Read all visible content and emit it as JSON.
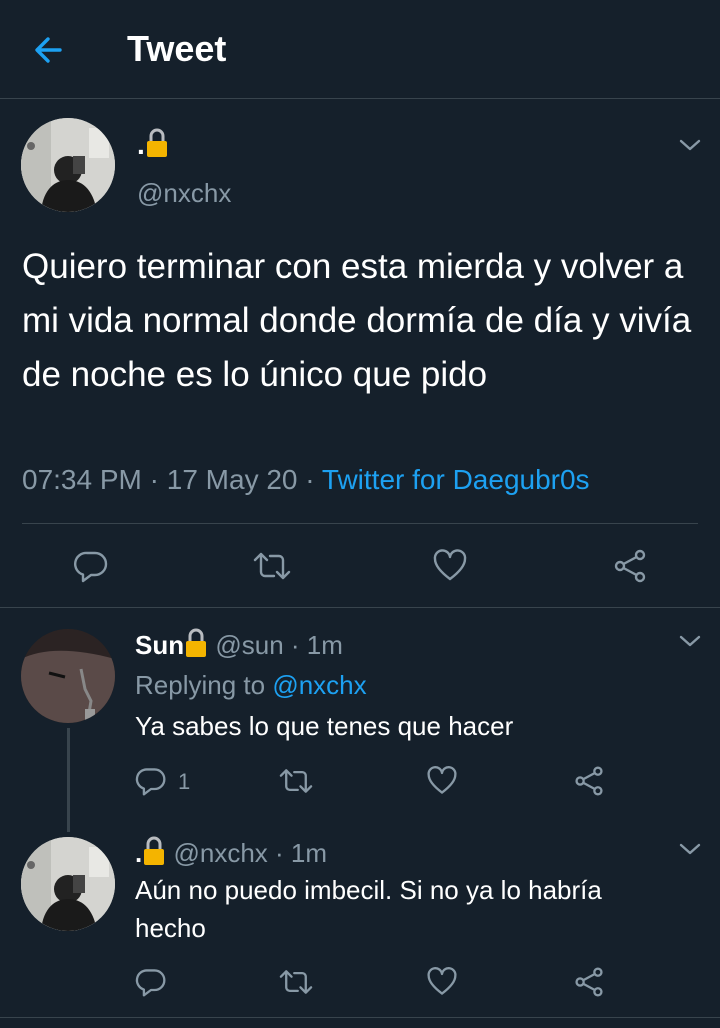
{
  "header": {
    "title": "Tweet"
  },
  "main_tweet": {
    "display_name": ".",
    "handle": "@nxchx",
    "text": "Quiero terminar con esta mierda y volver a mi vida normal donde dormía de día y vivía de noche es lo único que pido",
    "time": "07:34 PM",
    "date": "17 May 20",
    "source": "Twitter for Daegubr0s",
    "separator": " · "
  },
  "replies": [
    {
      "display_name": "Sun",
      "handle": "@sun",
      "time": "· 1m",
      "replying_prefix": "Replying to",
      "replying_handle": "@nxchx",
      "text": "Ya sabes lo que tenes que hacer",
      "reply_count": "1"
    },
    {
      "display_name": ".",
      "handle": "@nxchx",
      "time": "· 1m",
      "text": "Aún no puedo imbecil. Si no ya lo habría hecho"
    }
  ],
  "icons": [
    "back-arrow-icon",
    "lock-icon",
    "chevron-down-icon",
    "reply-icon",
    "retweet-icon",
    "like-icon",
    "share-icon"
  ],
  "colors": {
    "background": "#15202b",
    "accent": "#1da1f2",
    "secondary_text": "#8899a6",
    "lock": "#f4b400"
  }
}
